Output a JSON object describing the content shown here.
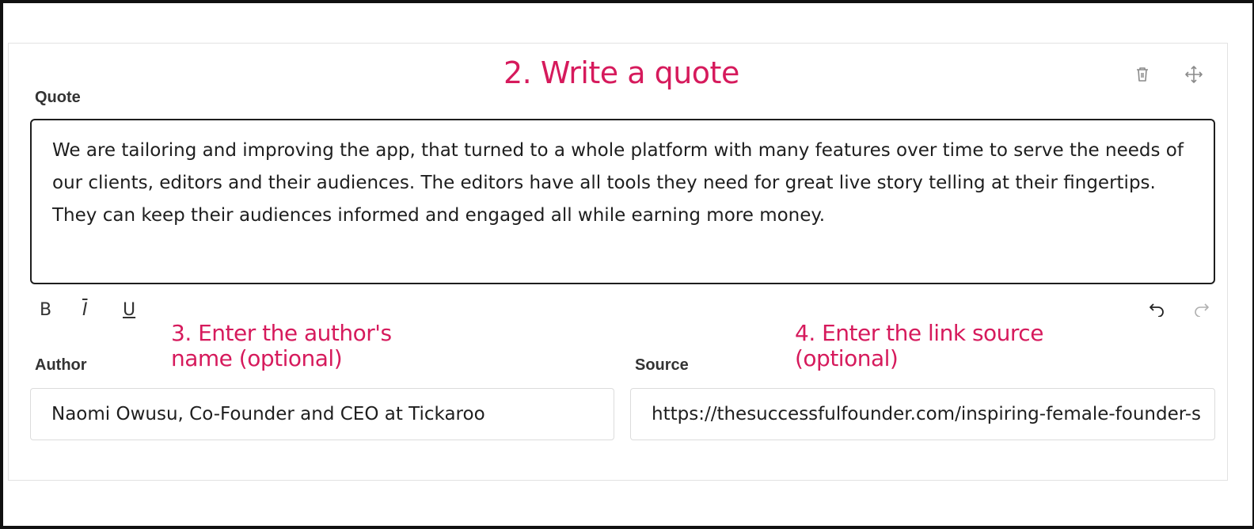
{
  "annotations": {
    "step2": "2. Write a quote",
    "step3_line1": "3. Enter the author's",
    "step3_line2": "name (optional)",
    "step4_line1": "4. Enter the link source",
    "step4_line2": "(optional)"
  },
  "quote": {
    "label": "Quote",
    "text": "We are tailoring and improving the app, that turned to a whole platform with many features over time to serve the needs of our clients, editors and their audiences. The editors have all tools they need for great live story telling at their fingertips. They can keep their audiences informed and engaged all while earning more money."
  },
  "toolbar": {
    "bold": "B",
    "italic": "I",
    "underline": "U"
  },
  "author": {
    "label": "Author",
    "value": "Naomi Owusu, Co-Founder and CEO at Tickaroo"
  },
  "source": {
    "label": "Source",
    "value": "https://thesuccessfulfounder.com/inspiring-female-founder-s"
  },
  "icons": {
    "delete": "trash-icon",
    "move": "move-icon",
    "undo": "undo-icon",
    "redo": "redo-icon"
  },
  "colors": {
    "annotation": "#d61a5c"
  }
}
